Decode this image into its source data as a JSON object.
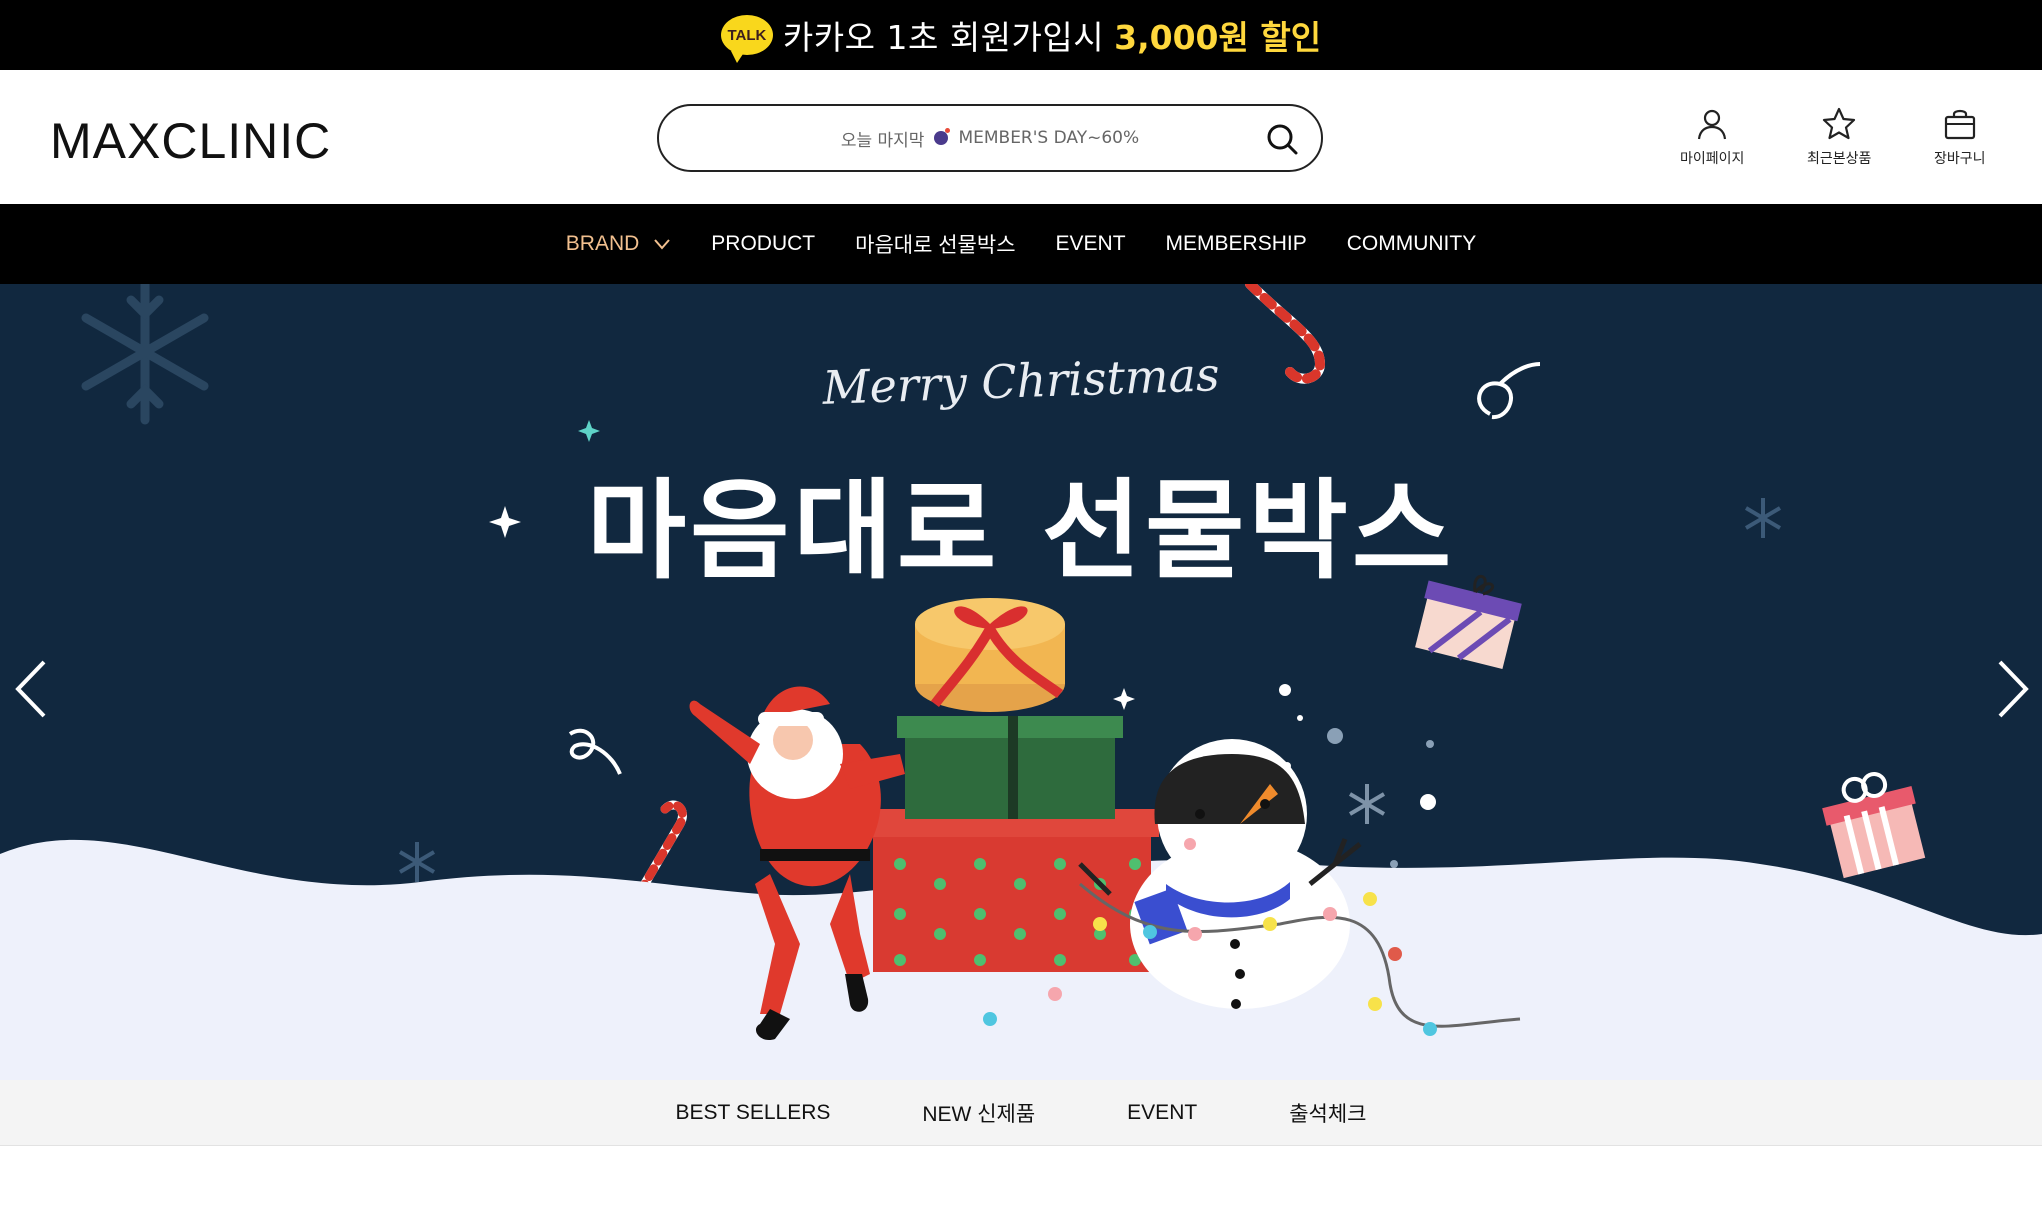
{
  "promo": {
    "talk_badge": "TALK",
    "text": "카카오 1초 회원가입시",
    "highlight": "3,000원 할인"
  },
  "header": {
    "logo": "MAXCLINIC",
    "search": {
      "placeholder_prefix": "오늘 마지막",
      "placeholder_suffix": "MEMBER'S DAY~60%"
    },
    "utilities": [
      {
        "label": "마이페이지",
        "icon": "user-icon"
      },
      {
        "label": "최근본상품",
        "icon": "star-icon"
      },
      {
        "label": "장바구니",
        "icon": "shopping-bag-icon"
      }
    ]
  },
  "nav": {
    "items": [
      {
        "label": "BRAND",
        "active": true,
        "has_dropdown": true
      },
      {
        "label": "PRODUCT"
      },
      {
        "label": "마음대로 선물박스"
      },
      {
        "label": "EVENT"
      },
      {
        "label": "MEMBERSHIP"
      },
      {
        "label": "COMMUNITY"
      }
    ],
    "active_color": "#f2c08f"
  },
  "hero": {
    "script_text": "Merry Christmas",
    "title": "마음대로 선물박스",
    "background": "#11283f",
    "snow_color": "#eef1fb"
  },
  "subtabs": {
    "items": [
      "BEST SELLERS",
      "NEW 신제품",
      "EVENT",
      "출석체크"
    ]
  }
}
